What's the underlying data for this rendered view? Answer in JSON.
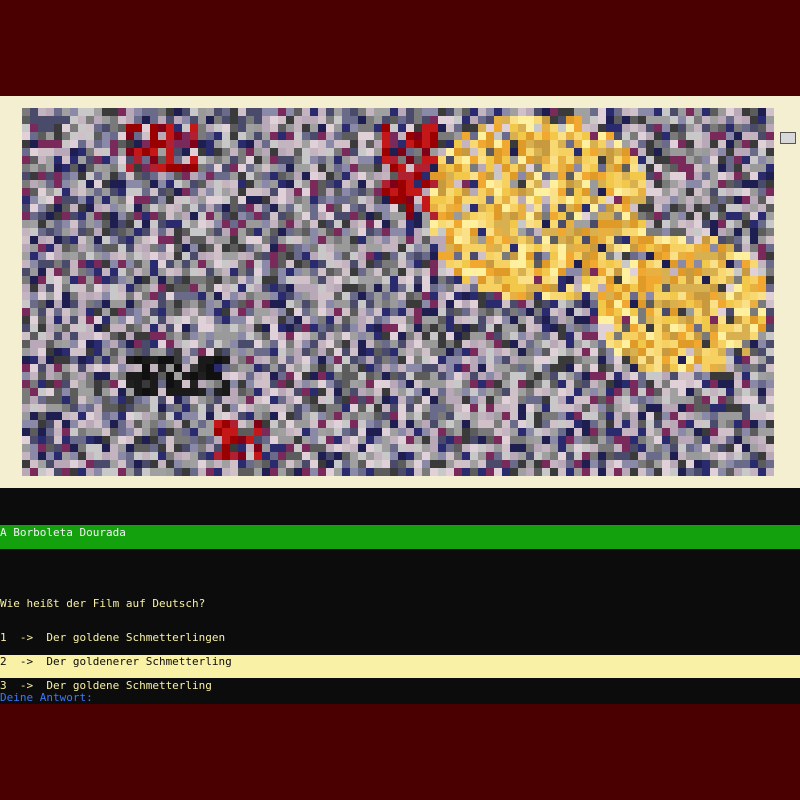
{
  "colors": {
    "outer_background": "#4a0000",
    "terminal_background": "#0c0c0c",
    "title_bar": "#13a10e",
    "text_yellow": "#f9f1a5",
    "prompt_blue": "#3b78ff"
  },
  "artwork": {
    "icon": "pixelated-movie-poster"
  },
  "game": {
    "film_title": "A Borboleta Dourada",
    "question": "Wie heißt der Film auf Deutsch?",
    "options": [
      {
        "text": "1  ->  Der goldene Schmetterlingen",
        "selected": false
      },
      {
        "text": "2  ->  Der goldenerer Schmetterling",
        "selected": true
      },
      {
        "text": "3  ->  Der goldene Schmetterling",
        "selected": false
      }
    ],
    "prompt": "Deine Antwort:"
  }
}
